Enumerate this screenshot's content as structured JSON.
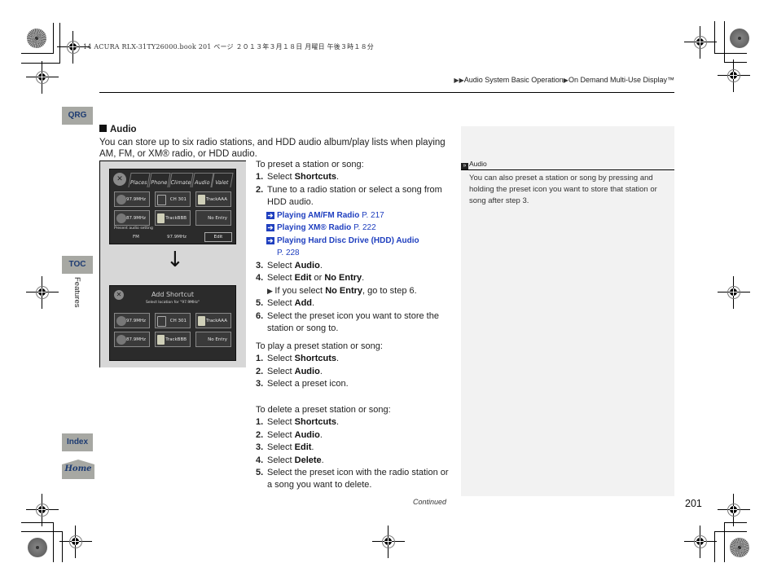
{
  "print_meta": "14 ACURA RLX-31TY26000.book  201 ページ  ２０１３年３月１８日  月曜日  午後３時１８分",
  "breadcrumb": {
    "items": [
      "Audio System Basic Operation",
      "On Demand Multi-Use Display™"
    ]
  },
  "side_tabs": {
    "qrg": "QRG",
    "toc": "TOC",
    "section": "Features",
    "index": "Index",
    "home": "Home"
  },
  "section": {
    "heading": "Audio",
    "intro": "You can store up to six radio stations, and HDD audio album/play lists when playing AM, FM, or XM® radio, or HDD audio."
  },
  "screens": {
    "shortcuts": {
      "tabs": [
        "Places",
        "Phone",
        "Climate",
        "Audio",
        "Valet"
      ],
      "cells": [
        "97.9MHz",
        "CH 301",
        "TrackAAA",
        "87.9MHz",
        "TrackBBB",
        "No Entry"
      ],
      "preset_label": "Present audio setting",
      "preset_band": "FM",
      "preset_freq": "97.9MHz",
      "edit_label": "Edit"
    },
    "add_shortcut": {
      "title": "Add Shortcut",
      "subtitle": "Select location for \"97.9MHz\"",
      "cells": [
        "97.9MHz",
        "CH 301",
        "TrackAAA",
        "87.9MHz",
        "TrackBBB",
        "No Entry"
      ]
    },
    "arrow": "↓"
  },
  "preset": {
    "intro": "To preset a station or song:",
    "step1": {
      "num": "1.",
      "pre": "Select ",
      "bold": "Shortcuts",
      "post": "."
    },
    "step2": {
      "num": "2.",
      "text": "Tune to a radio station or select a song from HDD audio."
    },
    "xrefs": [
      {
        "title": "Playing AM/FM Radio",
        "page": "P. 217"
      },
      {
        "title": "Playing XM® Radio",
        "page": "P. 222"
      },
      {
        "title": "Playing Hard Disc Drive (HDD) Audio",
        "page": "P. 228"
      }
    ],
    "step3": {
      "num": "3.",
      "pre": "Select ",
      "bold": "Audio",
      "post": "."
    },
    "step4": {
      "num": "4.",
      "pre": "Select ",
      "bold": "Edit",
      "mid": " or ",
      "bold2": "No Entry",
      "post": "."
    },
    "step4_note": {
      "pre": "If you select ",
      "bold": "No Entry",
      "post": ", go to step 6."
    },
    "step5": {
      "num": "5.",
      "pre": "Select ",
      "bold": "Add",
      "post": "."
    },
    "step6": {
      "num": "6.",
      "text": "Select the preset icon you want to store the station or song to."
    }
  },
  "play": {
    "intro": "To play a preset station or song:",
    "step1": {
      "num": "1.",
      "pre": "Select ",
      "bold": "Shortcuts",
      "post": "."
    },
    "step2": {
      "num": "2.",
      "pre": "Select ",
      "bold": "Audio",
      "post": "."
    },
    "step3": {
      "num": "3.",
      "text": "Select a preset icon."
    }
  },
  "delete": {
    "intro": "To delete a preset station or song:",
    "step1": {
      "num": "1.",
      "pre": "Select ",
      "bold": "Shortcuts",
      "post": "."
    },
    "step2": {
      "num": "2.",
      "pre": "Select ",
      "bold": "Audio",
      "post": "."
    },
    "step3": {
      "num": "3.",
      "pre": "Select ",
      "bold": "Edit",
      "post": "."
    },
    "step4": {
      "num": "4.",
      "pre": "Select ",
      "bold": "Delete",
      "post": "."
    },
    "step5": {
      "num": "5.",
      "text": "Select the preset icon with the radio station or a song you want to delete."
    }
  },
  "continued": "Continued",
  "note": {
    "title": "Audio",
    "text": "You can also preset a station or song by pressing and holding the preset icon you want to store that station or song after step 3."
  },
  "page_number": "201",
  "colors": {
    "tab_bg": "#a7a8a3",
    "tab_text": "#1d3b72",
    "link": "#1f3fbf",
    "note_bg": "#f2f2f2"
  }
}
